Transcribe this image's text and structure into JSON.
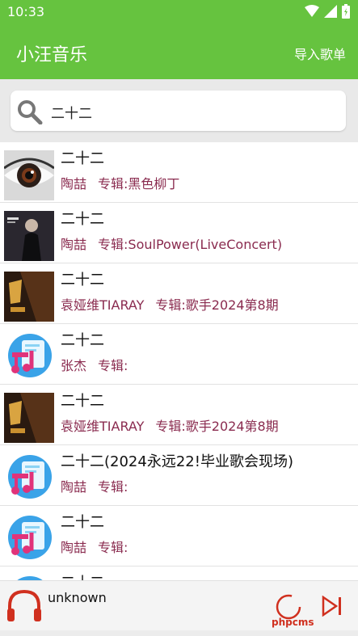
{
  "status": {
    "time": "10:33"
  },
  "app": {
    "title": "小汪音乐",
    "action": "导入歌单"
  },
  "search": {
    "value": "二十二"
  },
  "songs": [
    {
      "title": "二十二",
      "artist": "陶喆",
      "album": "专辑:黑色柳丁"
    },
    {
      "title": "二十二",
      "artist": "陶喆",
      "album": "专辑:SoulPower(LiveConcert)"
    },
    {
      "title": "二十二",
      "artist": "袁娅维TIARAY",
      "album": "专辑:歌手2024第8期"
    },
    {
      "title": "二十二",
      "artist": "张杰",
      "album": "专辑:"
    },
    {
      "title": "二十二",
      "artist": "袁娅维TIARAY",
      "album": "专辑:歌手2024第8期"
    },
    {
      "title": "二十二(2024永远22!毕业歌会现场)",
      "artist": "陶喆",
      "album": "专辑:"
    },
    {
      "title": "二十二",
      "artist": "陶喆",
      "album": "专辑:"
    },
    {
      "title": "二十二",
      "artist": "",
      "album": ""
    }
  ],
  "player": {
    "track": "unknown",
    "watermark": "phpcms"
  },
  "colors": {
    "accent": "#66c33f",
    "meta": "#8a2b4f",
    "player_icon": "#d0301f"
  }
}
